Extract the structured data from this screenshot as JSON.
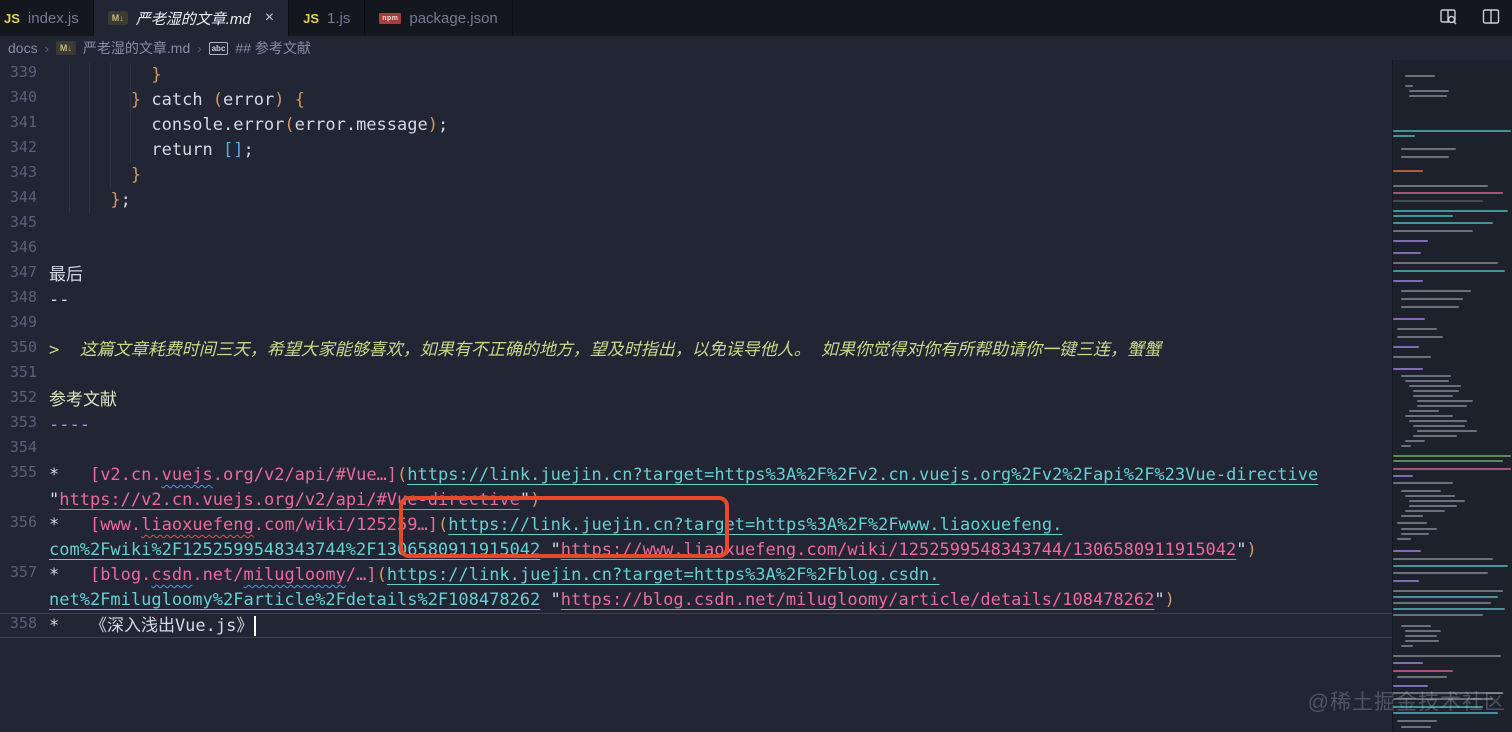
{
  "tabs": [
    {
      "label": "index.js",
      "icon": "js",
      "icon_text": "JS"
    },
    {
      "label": "严老湿的文章.md",
      "icon": "md",
      "icon_text": "M↓",
      "close": "×",
      "active": true
    },
    {
      "label": "1.js",
      "icon": "js",
      "icon_text": "JS"
    },
    {
      "label": "package.json",
      "icon": "npm",
      "icon_text": "npm"
    }
  ],
  "editor_actions": [
    {
      "name": "open-preview-side"
    },
    {
      "name": "split-editor"
    }
  ],
  "breadcrumb": {
    "separator": "›",
    "items": [
      {
        "label": "docs"
      },
      {
        "label": "严老湿的文章.md",
        "icon": "md",
        "icon_text": "M↓"
      },
      {
        "label": "## 参考文献",
        "icon": "abc",
        "icon_text": "abc"
      }
    ]
  },
  "colors": {
    "editor_bg": "#212534",
    "tabbar_bg": "#15171f",
    "accent_gold": "#d19a5f",
    "accent_pink": "#ed6a9e",
    "accent_teal": "#66cfd2",
    "accent_purple": "#a98de4",
    "quote_green": "#ccd687",
    "annotation_red": "#e4492a"
  },
  "code": {
    "rows": [
      {
        "num": "339",
        "segs": [
          {
            "t": "          "
          },
          {
            "t": "}",
            "c": "g"
          }
        ]
      },
      {
        "num": "340",
        "segs": [
          {
            "t": "        "
          },
          {
            "t": "}",
            "c": "g"
          },
          {
            "t": " catch ",
            "c": "w"
          },
          {
            "t": "(",
            "c": "g"
          },
          {
            "t": "error",
            "c": "w"
          },
          {
            "t": ")",
            "c": "g"
          },
          {
            "t": " ",
            "c": "w"
          },
          {
            "t": "{",
            "c": "g"
          }
        ]
      },
      {
        "num": "341",
        "segs": [
          {
            "t": "          console.error",
            "c": "w"
          },
          {
            "t": "(",
            "c": "g"
          },
          {
            "t": "error.message",
            "c": "w"
          },
          {
            "t": ")",
            "c": "g"
          },
          {
            "t": ";",
            "c": "w"
          }
        ]
      },
      {
        "num": "342",
        "segs": [
          {
            "t": "          return ",
            "c": "w"
          },
          {
            "t": "[]",
            "c": "b"
          },
          {
            "t": ";",
            "c": "w"
          }
        ]
      },
      {
        "num": "343",
        "segs": [
          {
            "t": "        "
          },
          {
            "t": "}",
            "c": "g"
          }
        ]
      },
      {
        "num": "344",
        "segs": [
          {
            "t": "      "
          },
          {
            "t": "}",
            "c": "g"
          },
          {
            "t": ";",
            "c": "w"
          }
        ]
      },
      {
        "num": "345",
        "segs": []
      },
      {
        "num": "346",
        "segs": []
      },
      {
        "num": "347",
        "segs": [
          {
            "t": "最后",
            "c": "w"
          }
        ]
      },
      {
        "num": "348",
        "segs": [
          {
            "t": "--",
            "c": "w"
          }
        ]
      },
      {
        "num": "349",
        "segs": []
      },
      {
        "num": "350",
        "segs": [
          {
            "t": ">  ",
            "c": "q"
          },
          {
            "t": "这篇文章耗费时间三天，希望大家能够喜欢，如果有不正确的地方，望及时指出，以免误导他人。 如果你觉得对你有所帮助请你一键三连，蟹蟹",
            "c": "q"
          }
        ]
      },
      {
        "num": "351",
        "segs": []
      },
      {
        "num": "352",
        "segs": [
          {
            "t": "参考文献",
            "c": "h"
          }
        ]
      },
      {
        "num": "353",
        "segs": [
          {
            "t": "----",
            "c": "v"
          }
        ]
      },
      {
        "num": "354",
        "segs": []
      },
      {
        "num": "355",
        "segs": [
          {
            "t": "*   ",
            "c": "w"
          },
          {
            "t": "[v2.cn.",
            "c": "pk"
          },
          {
            "t": "vuejs",
            "c": "pk",
            "sq": "blue"
          },
          {
            "t": ".org/v2/api/#Vue…]",
            "c": "pk"
          },
          {
            "t": "(",
            "c": "g"
          },
          {
            "t": "https://link.juejin.cn?target=https%3A%2F%2Fv2.cn.vuejs.org%2Fv2%2Fapi%2F%23Vue-directive",
            "c": "t",
            "link": true
          }
        ]
      },
      {
        "num": "",
        "segs": [
          {
            "t": "\"",
            "c": "w"
          },
          {
            "t": "https://v2.cn.vuejs.org/v2/api/#Vue-directive",
            "c": "pu",
            "link": true
          },
          {
            "t": "\"",
            "c": "w"
          },
          {
            "t": ")",
            "c": "g"
          }
        ]
      },
      {
        "num": "356",
        "segs": [
          {
            "t": "*   ",
            "c": "w"
          },
          {
            "t": "[www.",
            "c": "pk"
          },
          {
            "t": "liaoxuefeng",
            "c": "pk",
            "sq": "red"
          },
          {
            "t": ".com/wiki/125259…]",
            "c": "pk"
          },
          {
            "t": "(",
            "c": "g"
          },
          {
            "t": "https://link.juejin.cn?target=https%3A%2F%2Fwww.liaoxuefeng.",
            "c": "t",
            "link": true
          }
        ]
      },
      {
        "num": "",
        "segs": [
          {
            "t": "com%2Fwiki%2F1252599548343744%2F1306580911915042",
            "c": "t",
            "link": true
          },
          {
            "t": " \"",
            "c": "w"
          },
          {
            "t": "https://www.liaoxuefeng.com/wiki/1252599548343744/1306580911915042",
            "c": "pu",
            "link": true
          },
          {
            "t": "\"",
            "c": "w"
          },
          {
            "t": ")",
            "c": "g"
          }
        ]
      },
      {
        "num": "357",
        "segs": [
          {
            "t": "*   ",
            "c": "w"
          },
          {
            "t": "[blog.",
            "c": "pk"
          },
          {
            "t": "csdn",
            "c": "pk",
            "sq": "blue"
          },
          {
            "t": ".net/",
            "c": "pk"
          },
          {
            "t": "milugloomy",
            "c": "pk",
            "sq": "blue"
          },
          {
            "t": "/…]",
            "c": "pk"
          },
          {
            "t": "(",
            "c": "g"
          },
          {
            "t": "https://link.juejin.cn?target=https%3A%2F%2Fblog.csdn.",
            "c": "t",
            "link": true
          }
        ]
      },
      {
        "num": "",
        "segs": [
          {
            "t": "net%2Fmilugloomy%2Farticle%2Fdetails%2F108478262",
            "c": "t",
            "link": true
          },
          {
            "t": " \"",
            "c": "w"
          },
          {
            "t": "https://blog.csdn.net/milugloomy/article/details/108478262",
            "c": "pu",
            "link": true
          },
          {
            "t": "\"",
            "c": "w"
          },
          {
            "t": ")",
            "c": "g"
          }
        ]
      },
      {
        "num": "358",
        "segs": [
          {
            "t": "*   《深入浅出Vue.js》",
            "c": "w"
          }
        ],
        "cursor": true,
        "current": true
      }
    ]
  },
  "annotation": {
    "shape": "red-rounded-box"
  },
  "watermark": "@稀土掘金技术社区",
  "minimap_rows": [
    [
      75,
      12,
      30,
      "w"
    ],
    [
      85,
      12,
      8,
      "w"
    ],
    [
      90,
      16,
      40,
      "w"
    ],
    [
      95,
      16,
      38,
      "w"
    ],
    [
      130,
      0,
      118,
      "t"
    ],
    [
      135,
      0,
      22,
      "t"
    ],
    [
      148,
      8,
      55,
      "w"
    ],
    [
      156,
      8,
      48,
      "w"
    ],
    [
      170,
      0,
      30,
      "o"
    ],
    [
      185,
      0,
      95,
      "w"
    ],
    [
      192,
      0,
      110,
      "p"
    ],
    [
      200,
      0,
      90,
      "d"
    ],
    [
      210,
      0,
      115,
      "t"
    ],
    [
      215,
      0,
      60,
      "t"
    ],
    [
      222,
      0,
      100,
      "t"
    ],
    [
      230,
      0,
      80,
      "w"
    ],
    [
      240,
      0,
      35,
      "v"
    ],
    [
      252,
      0,
      28,
      "v"
    ],
    [
      262,
      0,
      105,
      "w"
    ],
    [
      270,
      0,
      112,
      "t"
    ],
    [
      280,
      0,
      30,
      "v"
    ],
    [
      290,
      8,
      70,
      "w"
    ],
    [
      298,
      8,
      62,
      "w"
    ],
    [
      306,
      8,
      58,
      "w"
    ],
    [
      318,
      0,
      32,
      "v"
    ],
    [
      328,
      4,
      40,
      "w"
    ],
    [
      336,
      4,
      46,
      "w"
    ],
    [
      346,
      0,
      26,
      "v"
    ],
    [
      356,
      0,
      38,
      "w"
    ],
    [
      368,
      0,
      30,
      "v"
    ],
    [
      375,
      8,
      50,
      "w"
    ],
    [
      380,
      12,
      44,
      "w"
    ],
    [
      385,
      16,
      52,
      "w"
    ],
    [
      390,
      20,
      46,
      "w"
    ],
    [
      395,
      20,
      40,
      "w"
    ],
    [
      400,
      24,
      56,
      "w"
    ],
    [
      405,
      24,
      50,
      "w"
    ],
    [
      410,
      16,
      30,
      "w"
    ],
    [
      415,
      12,
      48,
      "w"
    ],
    [
      420,
      16,
      58,
      "w"
    ],
    [
      425,
      20,
      52,
      "w"
    ],
    [
      430,
      24,
      60,
      "w"
    ],
    [
      435,
      20,
      44,
      "w"
    ],
    [
      440,
      12,
      20,
      "w"
    ],
    [
      445,
      8,
      10,
      "w"
    ],
    [
      455,
      0,
      118,
      "g"
    ],
    [
      460,
      0,
      110,
      "g"
    ],
    [
      468,
      0,
      118,
      "p"
    ],
    [
      475,
      0,
      20,
      "v"
    ],
    [
      482,
      0,
      60,
      "w"
    ],
    [
      490,
      8,
      40,
      "w"
    ],
    [
      495,
      12,
      50,
      "w"
    ],
    [
      500,
      16,
      56,
      "w"
    ],
    [
      505,
      16,
      48,
      "w"
    ],
    [
      510,
      12,
      40,
      "w"
    ],
    [
      515,
      8,
      22,
      "w"
    ],
    [
      522,
      4,
      30,
      "w"
    ],
    [
      528,
      8,
      36,
      "w"
    ],
    [
      533,
      8,
      28,
      "w"
    ],
    [
      538,
      4,
      14,
      "w"
    ],
    [
      550,
      0,
      28,
      "v"
    ],
    [
      558,
      0,
      100,
      "w"
    ],
    [
      565,
      0,
      115,
      "t"
    ],
    [
      572,
      0,
      95,
      "w"
    ],
    [
      580,
      0,
      26,
      "v"
    ],
    [
      590,
      0,
      110,
      "w"
    ],
    [
      596,
      0,
      105,
      "t"
    ],
    [
      602,
      0,
      98,
      "w"
    ],
    [
      608,
      0,
      112,
      "t"
    ],
    [
      614,
      0,
      90,
      "w"
    ],
    [
      625,
      8,
      30,
      "w"
    ],
    [
      630,
      12,
      36,
      "w"
    ],
    [
      635,
      12,
      32,
      "w"
    ],
    [
      640,
      12,
      34,
      "w"
    ],
    [
      645,
      8,
      12,
      "w"
    ],
    [
      655,
      0,
      108,
      "w"
    ],
    [
      662,
      0,
      30,
      "v"
    ],
    [
      670,
      0,
      60,
      "p"
    ],
    [
      676,
      4,
      50,
      "w"
    ],
    [
      685,
      0,
      35,
      "v"
    ],
    [
      692,
      0,
      110,
      "w"
    ],
    [
      698,
      0,
      100,
      "w"
    ],
    [
      706,
      0,
      90,
      "t"
    ],
    [
      712,
      0,
      105,
      "t"
    ],
    [
      720,
      4,
      40,
      "w"
    ],
    [
      726,
      8,
      30,
      "w"
    ]
  ]
}
